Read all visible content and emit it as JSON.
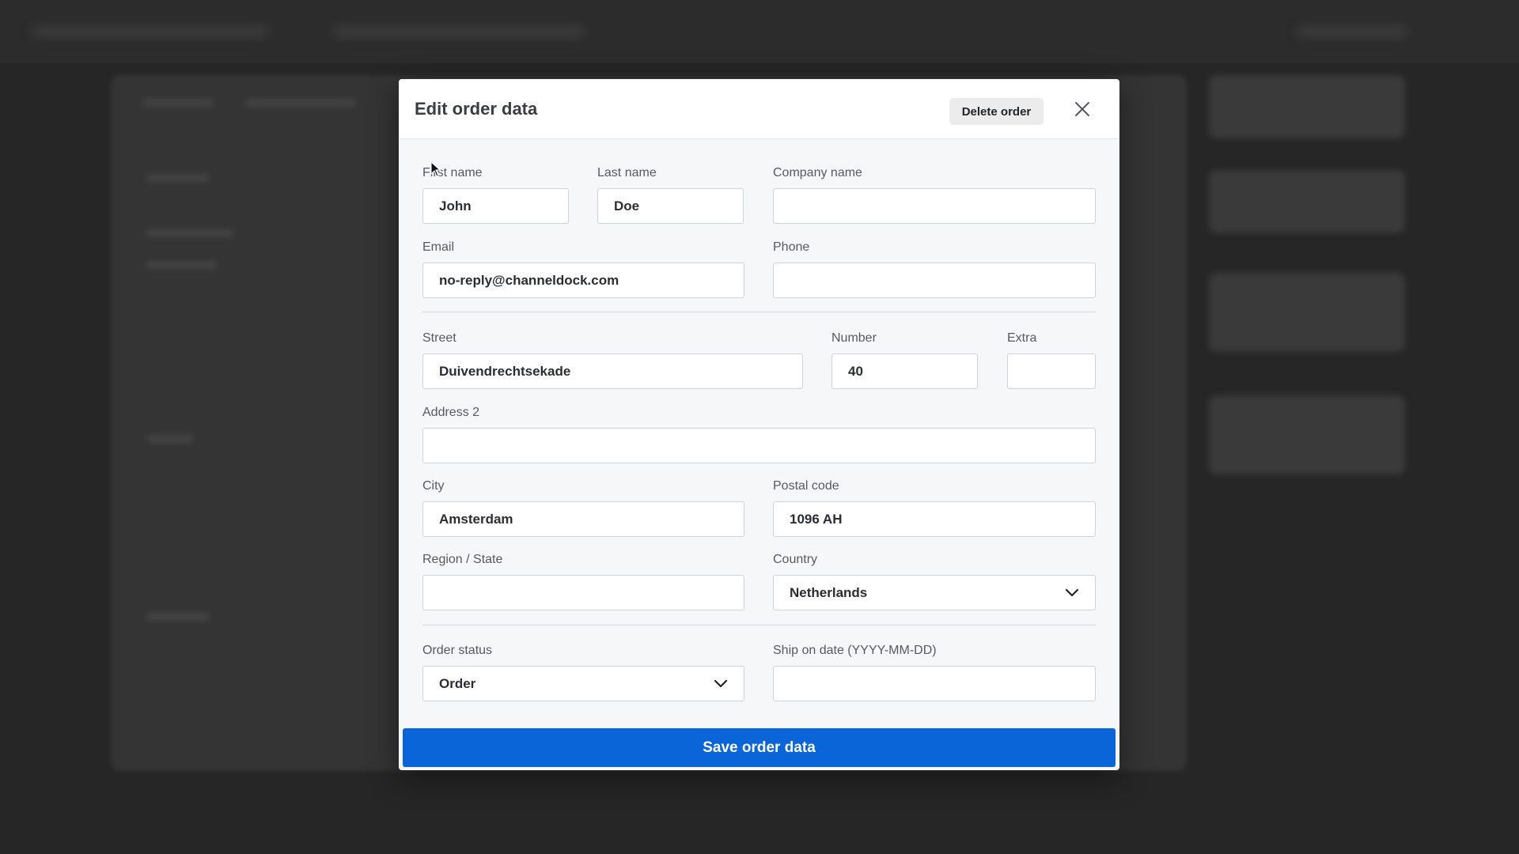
{
  "modal": {
    "title": "Edit order data",
    "delete_label": "Delete order",
    "close_icon": "close-icon",
    "save_label": "Save order data"
  },
  "fields": {
    "first_name": {
      "label": "First name",
      "value": "John"
    },
    "last_name": {
      "label": "Last name",
      "value": "Doe"
    },
    "company_name": {
      "label": "Company name",
      "value": ""
    },
    "email": {
      "label": "Email",
      "value": "no-reply@channeldock.com"
    },
    "phone": {
      "label": "Phone",
      "value": ""
    },
    "street": {
      "label": "Street",
      "value": "Duivendrechtsekade"
    },
    "number": {
      "label": "Number",
      "value": "40"
    },
    "extra": {
      "label": "Extra",
      "value": ""
    },
    "address2": {
      "label": "Address 2",
      "value": ""
    },
    "city": {
      "label": "City",
      "value": "Amsterdam"
    },
    "postal_code": {
      "label": "Postal code",
      "value": "1096 AH"
    },
    "region": {
      "label": "Region / State",
      "value": ""
    },
    "country": {
      "label": "Country",
      "value": "Netherlands"
    },
    "order_status": {
      "label": "Order status",
      "value": "Order"
    },
    "ship_on_date": {
      "label": "Ship on date (YYYY-MM-DD)",
      "value": ""
    }
  },
  "colors": {
    "primary": "#0a66d8",
    "overlay": "#2b2b2b"
  }
}
